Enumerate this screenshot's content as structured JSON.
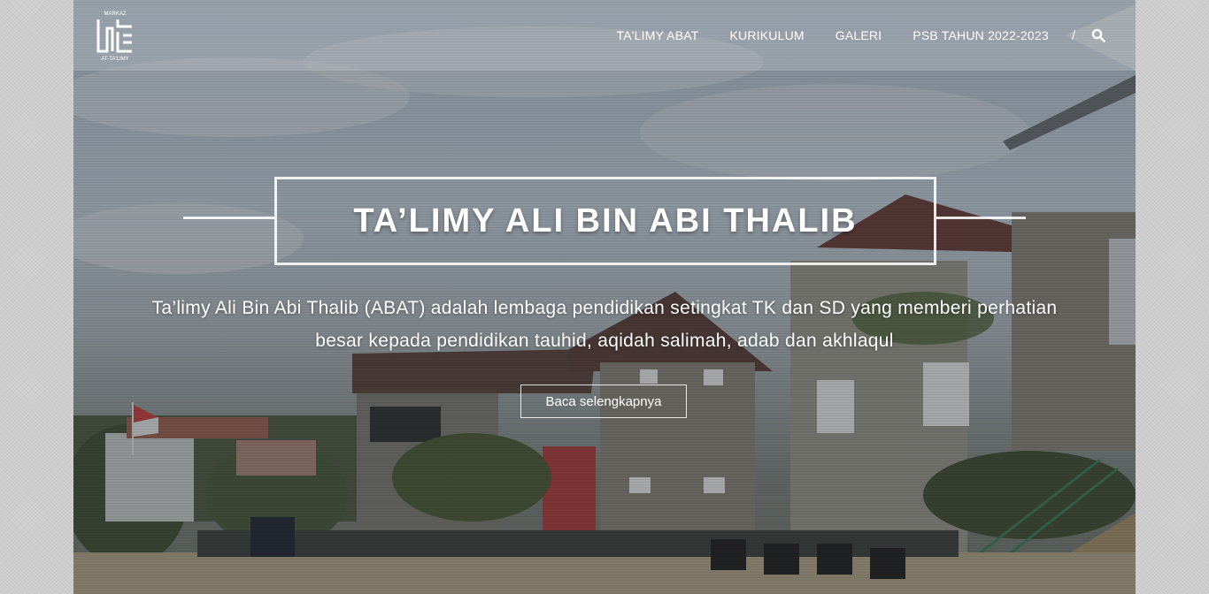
{
  "logo": {
    "top_text": "MARKAZ",
    "bottom_text": "AT-TA'LIMY"
  },
  "nav": {
    "items": [
      {
        "label": "TA'LIMY ABAT"
      },
      {
        "label": "KURIKULUM"
      },
      {
        "label": "GALERI"
      },
      {
        "label": "PSB TAHUN 2022-2023"
      }
    ],
    "separator": "/",
    "search_icon": "search-icon"
  },
  "hero": {
    "title": "TA’LIMY ALI BIN ABI THALIB",
    "description": "Ta’limy Ali Bin Abi Thalib (ABAT) adalah lembaga pendidikan setingkat TK dan SD yang memberi perhatian besar kepada pendidikan tauhid, aqidah salimah, adab dan akhlaqul",
    "cta_label": "Baca selengkapnya"
  },
  "colors": {
    "text": "#ffffff",
    "page_bg": "#d2d2d2"
  }
}
